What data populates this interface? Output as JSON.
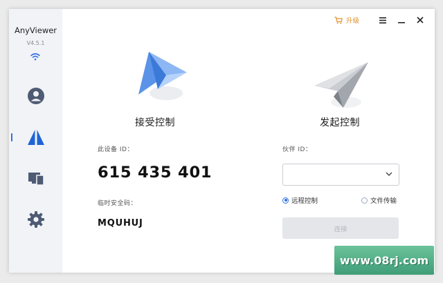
{
  "app": {
    "name": "AnyViewer",
    "version": "V4.5.1"
  },
  "sidebar": {
    "items": [
      {
        "name": "account",
        "icon": "user-icon"
      },
      {
        "name": "connect",
        "icon": "anyviewer-logo-icon",
        "active": true
      },
      {
        "name": "devices",
        "icon": "devices-icon"
      },
      {
        "name": "settings",
        "icon": "gear-icon"
      }
    ]
  },
  "titlebar": {
    "upgrade_label": "升级",
    "upgrade_color": "#e0902a"
  },
  "receive": {
    "title": "接受控制",
    "device_id_label": "此设备 ID：",
    "device_id": "615 435 401",
    "temp_pass_label": "临时安全码：",
    "temp_pass": "MQUHUJ"
  },
  "initiate": {
    "title": "发起控制",
    "partner_id_label": "伙伴 ID：",
    "partner_id_value": "",
    "options": [
      {
        "label": "远程控制",
        "checked": true
      },
      {
        "label": "文件传输",
        "checked": false
      }
    ],
    "connect_label": "连接"
  },
  "watermark": {
    "text": "www.08rj.com"
  },
  "colors": {
    "accent": "#2f6fe0",
    "sidebar_bg": "#f1f3f7",
    "icon_gray": "#4e5b73"
  }
}
